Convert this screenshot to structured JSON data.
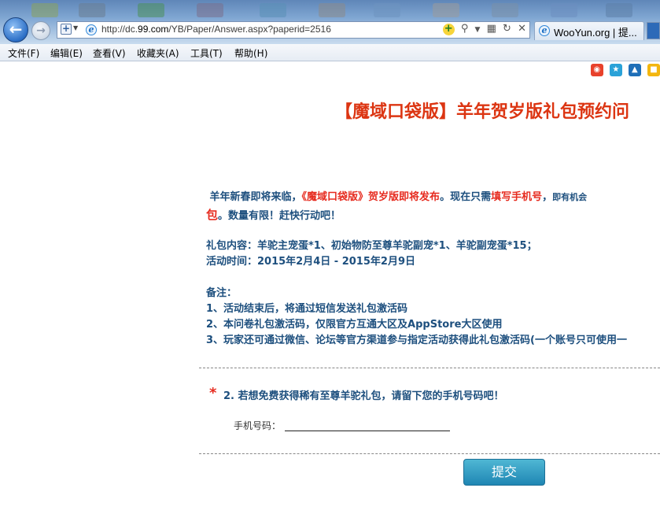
{
  "browser": {
    "address": {
      "prefix": "http://dc.",
      "host": "99.com",
      "path": "/YB/Paper/Answer.aspx?paperid=2516"
    },
    "tab": {
      "label": "WooYun.org | 提..."
    },
    "menu": [
      "文件(F)",
      "编辑(E)",
      "查看(V)",
      "收藏夹(A)",
      "工具(T)",
      "帮助(H)"
    ]
  },
  "share_icons": [
    "weibo-icon",
    "qzone-icon",
    "renren-icon",
    "douban-icon"
  ],
  "survey": {
    "title": "【魔域口袋版】羊年贺岁版礼包预约问",
    "intro": {
      "part1": "羊年新春即将来临，",
      "part2": "《魔域口袋版》贺岁版即将发布",
      "part3": "。现在只需",
      "part4": "填写手机号",
      "part5": "，",
      "part6": "即有机会",
      "part7": "包",
      "part8": "。数量有限！赶快行动吧！"
    },
    "gift_content": "礼包内容：羊驼主宠蛋*1、初始物防至尊羊驼副宠*1、羊驼副宠蛋*15；",
    "activity_time": "活动时间：2015年2月4日 - 2015年2月9日",
    "notes": {
      "heading": "备注：",
      "items": [
        "1、活动结束后，将通过短信发送礼包激活码",
        "2、本问卷礼包激活码，仅限官方互通大区及AppStore大区使用",
        "3、玩家还可通过微信、论坛等官方渠道参与指定活动获得此礼包激活码(一个账号只可使用一"
      ]
    },
    "question": {
      "star": "*",
      "text": "2. 若想免费获得稀有至尊羊驼礼包，请留下您的手机号码吧！",
      "phone_label": "手机号码：",
      "phone_value": ""
    },
    "submit_label": "提交"
  }
}
